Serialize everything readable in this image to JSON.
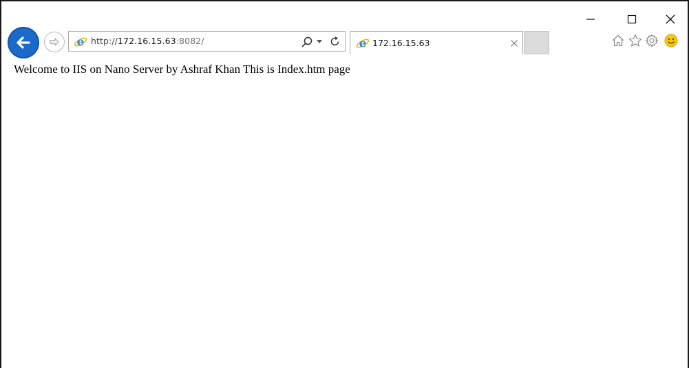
{
  "window": {
    "controls": [
      "minimize-icon",
      "maximize-icon",
      "close-icon"
    ]
  },
  "navigation": {
    "back_icon": "back-arrow-icon",
    "forward_icon": "forward-arrow-icon"
  },
  "address_bar": {
    "url_scheme": "http://",
    "url_host": "172.16.15.63",
    "url_port": ":8082/",
    "icons": [
      "ie-icon",
      "search-icon",
      "dropdown-icon",
      "refresh-icon"
    ]
  },
  "tabs": [
    {
      "title": "172.16.15.63",
      "active": true
    }
  ],
  "toolbar": {
    "icons": [
      "home-icon",
      "favorites-star-icon",
      "settings-gear-icon",
      "feedback-smiley-icon"
    ]
  },
  "page": {
    "body_text": "Welcome to IIS on Nano Server by Ashraf Khan This is Index.htm page"
  },
  "colors": {
    "back_button": "#1b6ac9",
    "ie_icon": "#2a8fd8",
    "smiley": "#f5c518"
  }
}
